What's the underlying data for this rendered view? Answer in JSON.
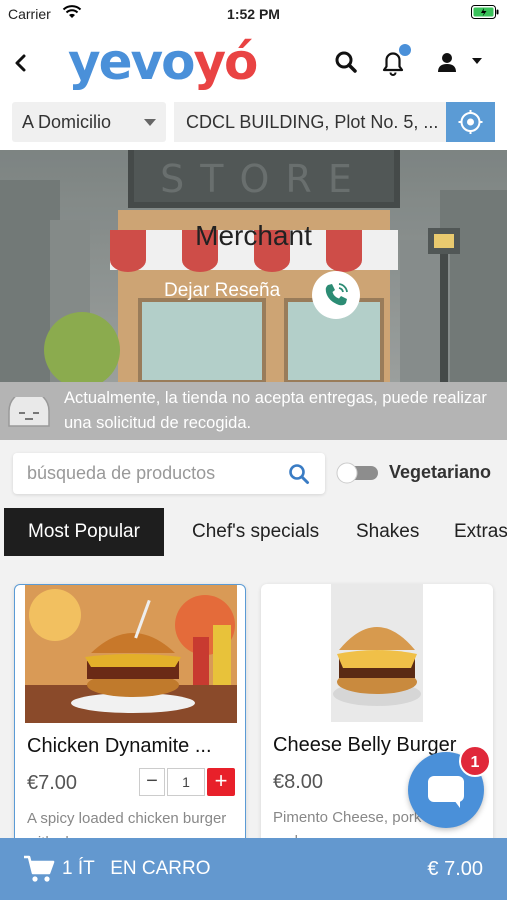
{
  "status_bar": {
    "carrier": "Carrier",
    "time": "1:52 PM"
  },
  "header": {
    "logo_part1": "yevo",
    "logo_part2": "yó"
  },
  "location": {
    "delivery_mode": "A Domicilio",
    "address": "CDCL BUILDING, Plot No. 5, ..."
  },
  "banner": {
    "merchant_name": "Merchant",
    "review_label": "Dejar Reseña",
    "sign_text": "STORE"
  },
  "notice": {
    "text": "Actualmente, la tienda no acepta entregas, puede realizar una solicitud de recogida."
  },
  "product_search": {
    "placeholder": "búsqueda de productos",
    "value": ""
  },
  "vegetarian": {
    "label": "Vegetariano",
    "enabled": false
  },
  "tabs": [
    {
      "label": "Most Popular",
      "active": true
    },
    {
      "label": "Chef's specials",
      "active": false
    },
    {
      "label": "Shakes",
      "active": false
    },
    {
      "label": "Extras",
      "active": false
    }
  ],
  "products": [
    {
      "name": "Chicken Dynamite ...",
      "price": "€7.00",
      "quantity": "1",
      "description": "A spicy loaded chicken burger with cheese..."
    },
    {
      "name": "Cheese Belly Burger",
      "price": "€8.00",
      "description": "Pimento Cheese, pork belly, and no nonsense..."
    }
  ],
  "chat": {
    "badge_count": "1"
  },
  "cart": {
    "label": "1 ÍT   EN CARRO",
    "total": "€ 7.00"
  },
  "colors": {
    "brand_blue": "#4a90d9",
    "brand_red": "#e94343",
    "cart_bar": "#6398cf",
    "plus_button": "#e8202a"
  },
  "icons": [
    "wifi-icon",
    "battery-icon",
    "back-arrow-icon",
    "search-icon",
    "bell-icon",
    "user-icon",
    "locate-icon",
    "phone-icon",
    "sleep-face-icon",
    "chat-icon",
    "cart-icon"
  ]
}
